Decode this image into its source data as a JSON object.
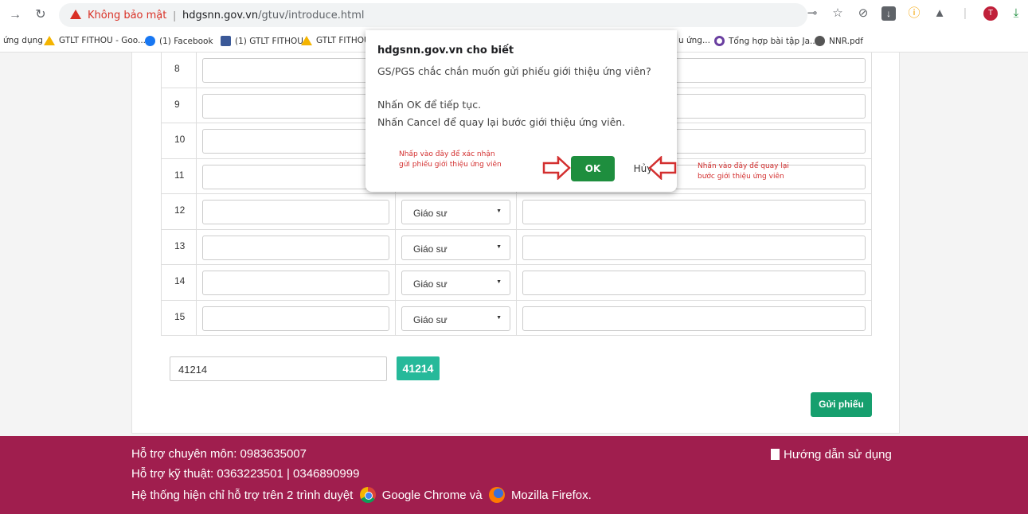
{
  "browser": {
    "security_label": "Không bảo mật",
    "url_host": "hdgsnn.gov.vn",
    "url_path": "/gtuv/introduce.html",
    "bookmarks": [
      {
        "label": "ứng dụng",
        "icon": "apps-icon"
      },
      {
        "label": "GTLT FITHOU - Goo...",
        "icon": "drive-icon"
      },
      {
        "label": "(1) Facebook",
        "icon": "facebook-icon"
      },
      {
        "label": "(1) GTLT FITHOU",
        "icon": "facebook-icon"
      },
      {
        "label": "GTLT FITHOU",
        "icon": "drive-icon"
      },
      {
        "label": "u ứng...",
        "icon": ""
      },
      {
        "label": "Tổng hợp bài tập Ja...",
        "icon": "at-icon"
      },
      {
        "label": "NNR.pdf",
        "icon": "globe-icon"
      }
    ]
  },
  "table": {
    "rows": [
      {
        "num": "8",
        "select": ""
      },
      {
        "num": "9",
        "select": ""
      },
      {
        "num": "10",
        "select": ""
      },
      {
        "num": "11",
        "select": ""
      },
      {
        "num": "12",
        "select": "Giáo sư"
      },
      {
        "num": "13",
        "select": "Giáo sư"
      },
      {
        "num": "14",
        "select": "Giáo sư"
      },
      {
        "num": "15",
        "select": "Giáo sư"
      }
    ]
  },
  "captcha": {
    "input_value": "41214",
    "code": "41214"
  },
  "submit_label": "Gửi phiếu",
  "footer": {
    "line1": "Hỗ trợ chuyên môn: 0983635007",
    "line2": "Hỗ trợ kỹ thuật: 0363223501 | 0346890999",
    "line3_pre": "Hệ thống hiện chỉ hỗ trợ trên 2 trình duyệt",
    "chrome": "Google Chrome và",
    "firefox": "Mozilla Firefox.",
    "guide": "Hướng dẫn sử dụng"
  },
  "dialog": {
    "title": "hdgsnn.gov.vn cho biết",
    "msg1": "GS/PGS chắc chắn muốn gửi phiếu giới thiệu ứng viên?",
    "msg2": "Nhấn OK để tiếp tục.",
    "msg3": "Nhấn Cancel để quay lại bước giới thiệu ứng viên.",
    "ok": "OK",
    "cancel": "Hủy"
  },
  "annotations": {
    "left_line1": "Nhấp vào đây để xác nhận",
    "left_line2": "gửi phiếu giới thiệu ứng viên",
    "right_line1": "Nhấn vào đây để quay lại",
    "right_line2": "bước giới thiệu ứng viên",
    "color": "#d32f2f"
  }
}
